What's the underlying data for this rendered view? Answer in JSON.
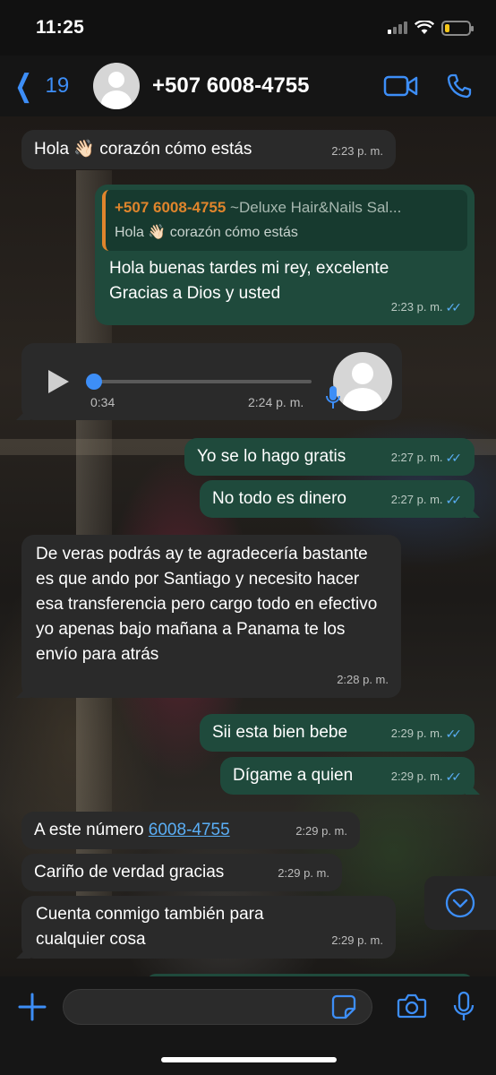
{
  "status_bar": {
    "time": "11:25",
    "battery_level": 0.2,
    "battery_color": "#f5c518"
  },
  "header": {
    "back_count": "19",
    "contact": "+507 6008-4755",
    "accent_color": "#3d8ef7",
    "icons": [
      "chevron-left-icon",
      "video-call-icon",
      "phone-icon"
    ]
  },
  "messages": [
    {
      "dir": "in",
      "text": "Hola 👋🏻 corazón cómo estás",
      "time": "2:23 p. m."
    },
    {
      "dir": "out",
      "quote": {
        "author": "+507 6008-4755",
        "tag": "~Deluxe Hair&Nails Sal...",
        "text": "Hola 👋🏻 corazón cómo estás"
      },
      "text": "Hola buenas tardes mi rey, excelente Gracias a Dios y usted",
      "time": "2:23 p. m."
    },
    {
      "dir": "in",
      "type": "voice",
      "duration": "0:34",
      "time": "2:24 p. m.",
      "progress": 0
    },
    {
      "dir": "out",
      "text": "Yo se lo hago gratis",
      "time": "2:27 p. m."
    },
    {
      "dir": "out",
      "text": "No todo es dinero",
      "time": "2:27 p. m."
    },
    {
      "dir": "in",
      "text": "De veras podrás ay te agradecería bastante es que ando por Santiago y necesito hacer esa transferencia pero cargo todo en efectivo yo apenas bajo mañana a Panama te los envío para atrás",
      "time": "2:28 p. m."
    },
    {
      "dir": "out",
      "text": "Sii esta bien bebe",
      "time": "2:29 p. m."
    },
    {
      "dir": "out",
      "text": "Dígame a quien",
      "time": "2:29 p. m."
    },
    {
      "dir": "in",
      "text_prefix": "A este número ",
      "link": "6008-4755",
      "time": "2:29 p. m."
    },
    {
      "dir": "in",
      "text": "Cariño de verdad gracias",
      "time": "2:29 p. m."
    },
    {
      "dir": "in",
      "text": "Cuenta conmigo también para cualquier cosa",
      "time": "2:29 p. m."
    }
  ],
  "input_bar": {
    "placeholder": "",
    "icons": [
      "plus-icon",
      "sticker-icon",
      "camera-icon",
      "microphone-icon"
    ]
  },
  "colors": {
    "incoming_bubble": "#2a2a2a",
    "outgoing_bubble": "#1f4a3c",
    "read_ticks": "#5aaef5",
    "quote_accent": "#e0852c"
  }
}
